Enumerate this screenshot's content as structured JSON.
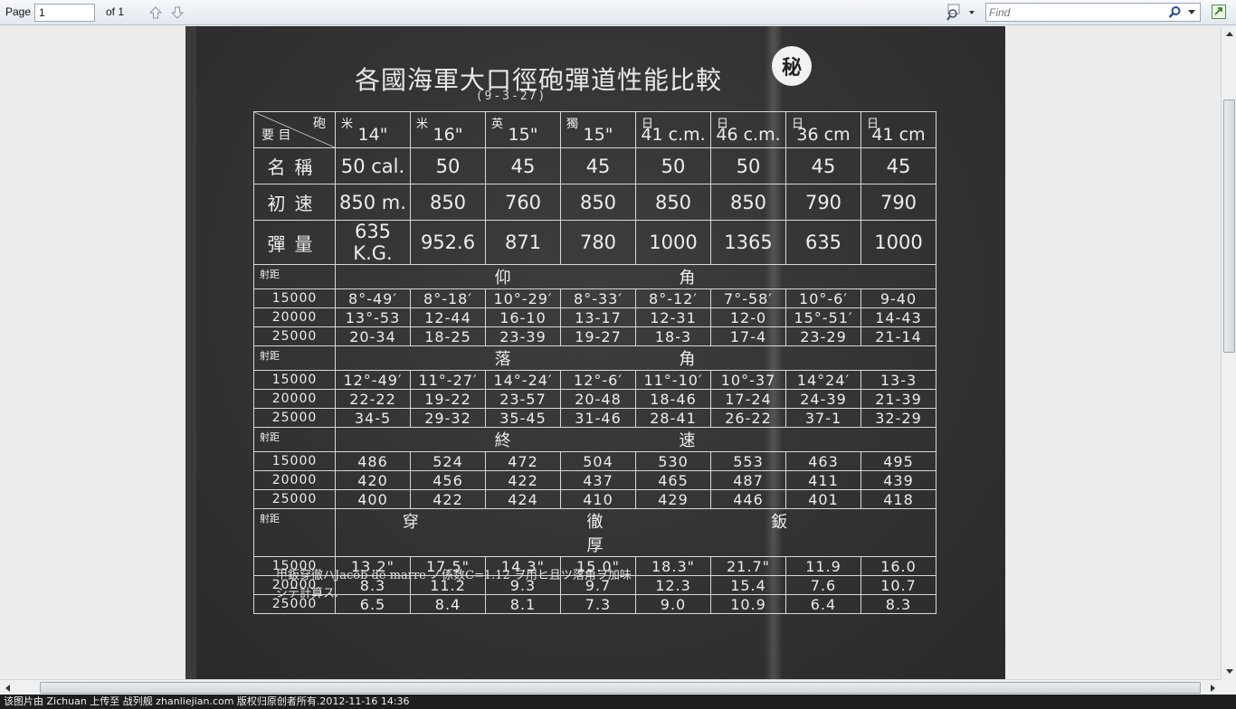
{
  "toolbar": {
    "page_label": "Page",
    "page_value": "1",
    "page_of": "of 1",
    "find_placeholder": "Find"
  },
  "document": {
    "title": "各國海軍大口徑砲彈道性能比較",
    "date": "(9-3-27)",
    "stamp": "秘",
    "corner_gun": "砲",
    "corner_item": "要 目",
    "guns": [
      {
        "nation": "米",
        "caliber": "14\""
      },
      {
        "nation": "米",
        "caliber": "16\""
      },
      {
        "nation": "英",
        "caliber": "15\""
      },
      {
        "nation": "獨",
        "caliber": "15\""
      },
      {
        "nation": "日",
        "caliber": "41 c.m."
      },
      {
        "nation": "日",
        "caliber": "46 c.m."
      },
      {
        "nation": "日",
        "caliber": "36 cm"
      },
      {
        "nation": "日",
        "caliber": "41 cm"
      }
    ],
    "spec_rows": [
      {
        "label": "名稱",
        "values": [
          "50 cal.",
          "50",
          "45",
          "45",
          "50",
          "50",
          "45",
          "45"
        ]
      },
      {
        "label": "初速",
        "values": [
          "850 m.",
          "850",
          "760",
          "850",
          "850",
          "850",
          "790",
          "790"
        ]
      },
      {
        "label": "彈量",
        "values": [
          "635 K.G.",
          "952.6",
          "871",
          "780",
          "1000",
          "1365",
          "635",
          "1000"
        ]
      }
    ],
    "sections": [
      {
        "range_label": "射距",
        "title": "仰 角",
        "rows": [
          {
            "range": "15000",
            "values": [
              "8°-49′",
              "8°-18′",
              "10°-29′",
              "8°-33′",
              "8°-12′",
              "7°-58′",
              "10°-6′",
              "9-40"
            ]
          },
          {
            "range": "20000",
            "values": [
              "13°-53",
              "12-44",
              "16-10",
              "13-17",
              "12-31",
              "12-0",
              "15°-51′",
              "14-43"
            ]
          },
          {
            "range": "25000",
            "values": [
              "20-34",
              "18-25",
              "23-39",
              "19-27",
              "18-3",
              "17-4",
              "23-29",
              "21-14"
            ]
          }
        ]
      },
      {
        "range_label": "射距",
        "title": "落 角",
        "rows": [
          {
            "range": "15000",
            "values": [
              "12°-49′",
              "11°-27′",
              "14°-24′",
              "12°-6′",
              "11°-10′",
              "10°-37",
              "14°24′",
              "13-3"
            ]
          },
          {
            "range": "20000",
            "values": [
              "22-22",
              "19-22",
              "23-57",
              "20-48",
              "18-46",
              "17-24",
              "24-39",
              "21-39"
            ]
          },
          {
            "range": "25000",
            "values": [
              "34-5",
              "29-32",
              "35-45",
              "31-46",
              "28-41",
              "26-22",
              "37-1",
              "32-29"
            ]
          }
        ]
      },
      {
        "range_label": "射距",
        "title": "終 速",
        "rows": [
          {
            "range": "15000",
            "values": [
              "486",
              "524",
              "472",
              "504",
              "530",
              "553",
              "463",
              "495"
            ]
          },
          {
            "range": "20000",
            "values": [
              "420",
              "456",
              "422",
              "437",
              "465",
              "487",
              "411",
              "439"
            ]
          },
          {
            "range": "25000",
            "values": [
              "400",
              "422",
              "424",
              "410",
              "429",
              "446",
              "401",
              "418"
            ]
          }
        ]
      },
      {
        "range_label": "射距",
        "title": "穿 徹 鈑 厚",
        "rows": [
          {
            "range": "15000",
            "values": [
              "13.2\"",
              "17.5\"",
              "14.3\"",
              "15.0\"",
              "18.3\"",
              "21.7\"",
              "11.9",
              "16.0"
            ]
          },
          {
            "range": "20000",
            "values": [
              "8.3",
              "11.2",
              "9.3",
              "9.7",
              "12.3",
              "15.4",
              "7.6",
              "10.7"
            ]
          },
          {
            "range": "25000",
            "values": [
              "6.5",
              "8.4",
              "8.1",
              "7.3",
              "9.0",
              "10.9",
              "6.4",
              "8.3"
            ]
          }
        ]
      }
    ],
    "footnote_line1": "甲鈑穿徹ハJacob de marre ノ係数C=1.12 ヲ用ヒ且ツ落角ヲ加味",
    "footnote_line2": "シテ計算ス."
  },
  "status": {
    "text": "该图片由 Zichuan 上传至 战列舰 zhanliejian.com 版权归原创者所有.2012-11-16 14:36"
  }
}
